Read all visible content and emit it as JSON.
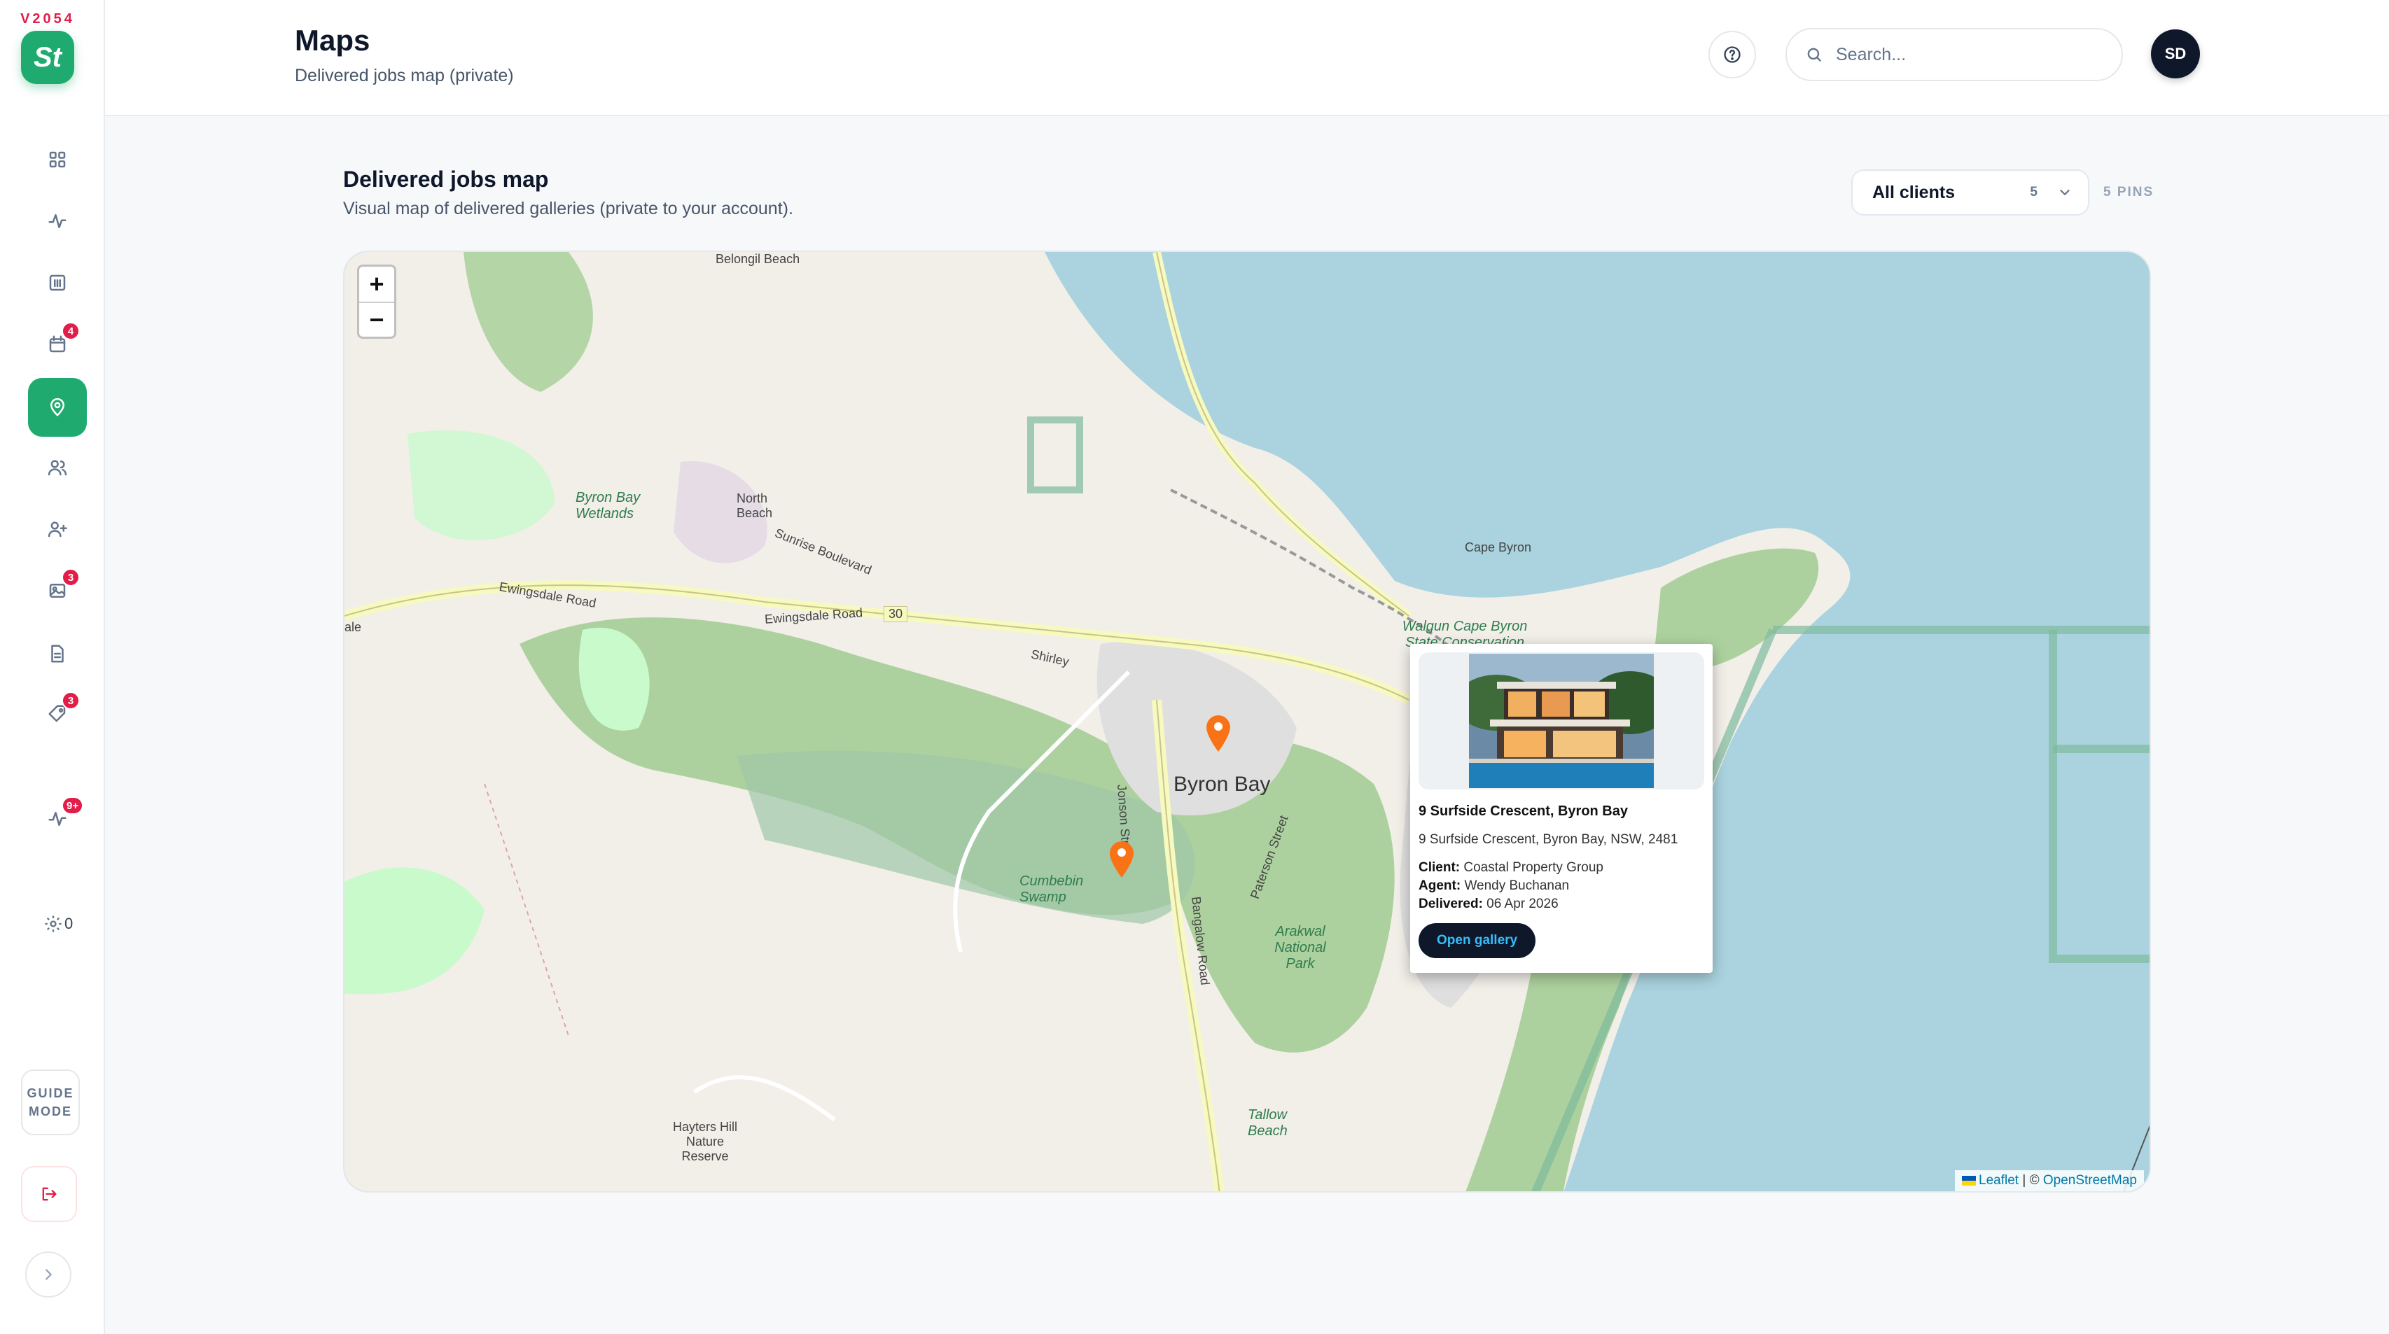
{
  "app": {
    "version": "V2054",
    "logo_text": "St"
  },
  "sidebar": {
    "items": [
      {
        "name": "dashboard",
        "icon": "grid-icon",
        "badge": ""
      },
      {
        "name": "activity",
        "icon": "activity-icon",
        "badge": ""
      },
      {
        "name": "reports",
        "icon": "chart-icon",
        "badge": ""
      },
      {
        "name": "calendar",
        "icon": "calendar-icon",
        "badge": "4"
      },
      {
        "name": "maps",
        "icon": "map-pin-icon",
        "badge": ""
      },
      {
        "name": "clients",
        "icon": "users-icon",
        "badge": ""
      },
      {
        "name": "agents",
        "icon": "user-plus-icon",
        "badge": ""
      },
      {
        "name": "galleries",
        "icon": "image-icon",
        "badge": "3"
      },
      {
        "name": "invoices",
        "icon": "file-icon",
        "badge": ""
      },
      {
        "name": "tags",
        "icon": "tag-icon",
        "badge": "3"
      },
      {
        "name": "pulse",
        "icon": "pulse-icon",
        "badge": "9+"
      }
    ],
    "settings_count": "0",
    "guide_label": "GUIDE MODE"
  },
  "header": {
    "title": "Maps",
    "subtitle": "Delivered jobs map (private)",
    "search_placeholder": "Search...",
    "avatar_initials": "SD"
  },
  "main": {
    "title": "Delivered jobs map",
    "subtitle": "Visual map of delivered galleries (private to your account).",
    "client_filter": {
      "label": "All clients",
      "count": "5"
    },
    "pins_label": "5 PINS"
  },
  "map": {
    "labels": {
      "north_beach": "North Beach",
      "belongil_beach": "Belongil Beach",
      "byron_bay_wetlands": "Byron Bay Wetlands",
      "byron_bay": "Byron Bay",
      "cumbebin_swamp": "Cumbebin Swamp",
      "cape_byron": "Cape Byron",
      "walgun": "Walgun Cape Byron State Conservation Area",
      "arakwal": "Arakwal National Park",
      "tallow_beach": "Tallow Beach",
      "ewingsdale_road": "Ewingsdale Road",
      "route_30": "30",
      "haylters": "Hayters Hill Nature Reserve",
      "jonson_street": "Jonson Street",
      "bangalow_road": "Bangalow Road",
      "paterson_street": "Paterson Street",
      "sunrise_boulevard": "Sunrise Boulevard",
      "shirley": "Shirley",
      "ale": "ale"
    },
    "zoom_in": "+",
    "zoom_out": "−",
    "attribution_leaflet": "Leaflet",
    "attribution_sep": " | © ",
    "attribution_osm": "OpenStreetMap",
    "colors": {
      "water": "#aad3df",
      "land": "#f2efe9",
      "forest": "#add19e",
      "wetland": "#9fc7a8",
      "park": "#c8facc",
      "pin": "#f97316"
    }
  },
  "popup": {
    "title": "9 Surfside Crescent, Byron Bay",
    "address": "9 Surfside Crescent, Byron Bay, NSW, 2481",
    "client_label": "Client:",
    "client": "Coastal Property Group",
    "agent_label": "Agent:",
    "agent": "Wendy Buchanan",
    "delivered_label": "Delivered:",
    "delivered": "06 Apr 2026",
    "button": "Open gallery"
  }
}
